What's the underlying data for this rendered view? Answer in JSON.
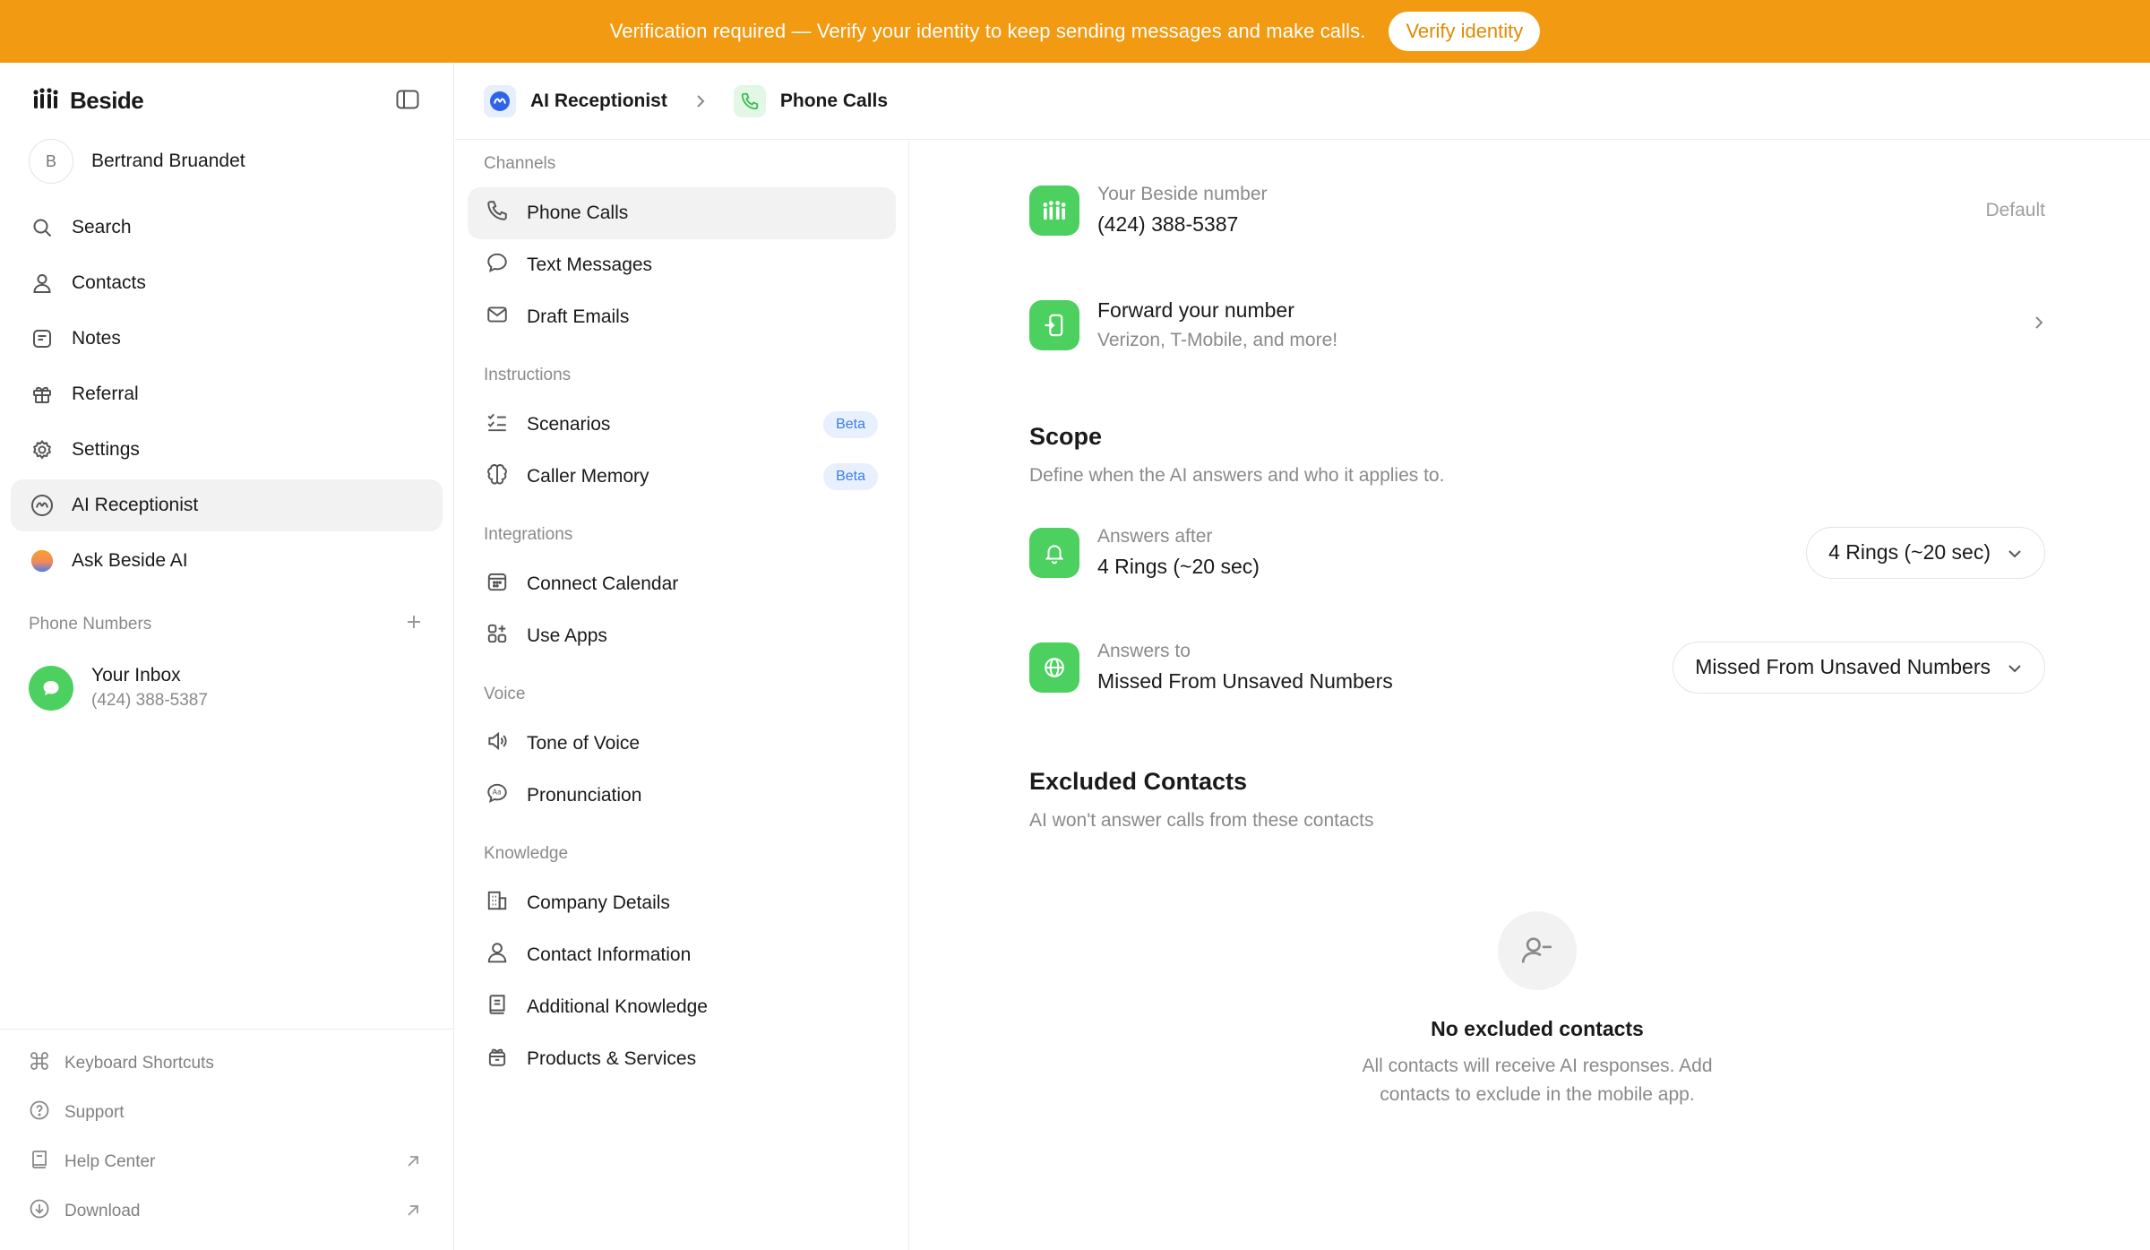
{
  "banner": {
    "text": "Verification required — Verify your identity to keep sending messages and make calls.",
    "button": "Verify identity",
    "color": "#f29b12"
  },
  "sidebar": {
    "brand": "Beside",
    "user": {
      "initial": "B",
      "name": "Bertrand Bruandet"
    },
    "items": [
      {
        "label": "Search",
        "icon": "search-icon"
      },
      {
        "label": "Contacts",
        "icon": "person-icon"
      },
      {
        "label": "Notes",
        "icon": "note-icon"
      },
      {
        "label": "Referral",
        "icon": "gift-icon"
      },
      {
        "label": "Settings",
        "icon": "gear-icon"
      },
      {
        "label": "AI Receptionist",
        "icon": "ai-receptionist-icon",
        "active": true
      },
      {
        "label": "Ask Beside AI",
        "icon": "gradient-orb-icon"
      }
    ],
    "phone_numbers": {
      "label": "Phone Numbers",
      "inbox": {
        "title": "Your Inbox",
        "number": "(424) 388-5387"
      }
    },
    "footer": [
      {
        "label": "Keyboard Shortcuts",
        "icon": "command-icon"
      },
      {
        "label": "Support",
        "icon": "help-circle-icon"
      },
      {
        "label": "Help Center",
        "icon": "book-icon",
        "external": true
      },
      {
        "label": "Download",
        "icon": "download-icon",
        "external": true
      }
    ]
  },
  "header": {
    "crumb1": "AI Receptionist",
    "crumb2": "Phone Calls"
  },
  "menu": {
    "groups": [
      {
        "label": "Channels",
        "items": [
          {
            "label": "Phone Calls",
            "icon": "phone-icon",
            "active": true
          },
          {
            "label": "Text Messages",
            "icon": "chat-bubble-icon"
          },
          {
            "label": "Draft Emails",
            "icon": "mail-icon"
          }
        ]
      },
      {
        "label": "Instructions",
        "items": [
          {
            "label": "Scenarios",
            "icon": "checklist-icon",
            "badge": "Beta"
          },
          {
            "label": "Caller Memory",
            "icon": "brain-icon",
            "badge": "Beta"
          }
        ]
      },
      {
        "label": "Integrations",
        "items": [
          {
            "label": "Connect Calendar",
            "icon": "calendar-icon"
          },
          {
            "label": "Use Apps",
            "icon": "apps-icon"
          }
        ]
      },
      {
        "label": "Voice",
        "items": [
          {
            "label": "Tone of Voice",
            "icon": "speaker-icon"
          },
          {
            "label": "Pronunciation",
            "icon": "speech-icon"
          }
        ]
      },
      {
        "label": "Knowledge",
        "items": [
          {
            "label": "Company Details",
            "icon": "building-icon"
          },
          {
            "label": "Contact Information",
            "icon": "person-icon"
          },
          {
            "label": "Additional Knowledge",
            "icon": "book-icon"
          },
          {
            "label": "Products & Services",
            "icon": "box-icon"
          }
        ]
      }
    ]
  },
  "main": {
    "beside_number": {
      "label": "Your Beside number",
      "value": "(424) 388-5387",
      "tag": "Default"
    },
    "forward": {
      "title": "Forward your number",
      "sub": "Verizon, T-Mobile, and more!"
    },
    "scope": {
      "title": "Scope",
      "desc": "Define when the AI answers and who it applies to.",
      "answers_after": {
        "label": "Answers after",
        "value": "4 Rings (~20 sec)",
        "selected": "4 Rings (~20 sec)"
      },
      "answers_to": {
        "label": "Answers to",
        "value": "Missed From Unsaved Numbers",
        "selected": "Missed From Unsaved Numbers"
      }
    },
    "excluded": {
      "title": "Excluded Contacts",
      "desc": "AI won't answer calls from these contacts",
      "empty_title": "No excluded contacts",
      "empty_text": "All contacts will receive AI responses. Add contacts to exclude in the mobile app."
    },
    "accent_green": "#4cd05f"
  }
}
